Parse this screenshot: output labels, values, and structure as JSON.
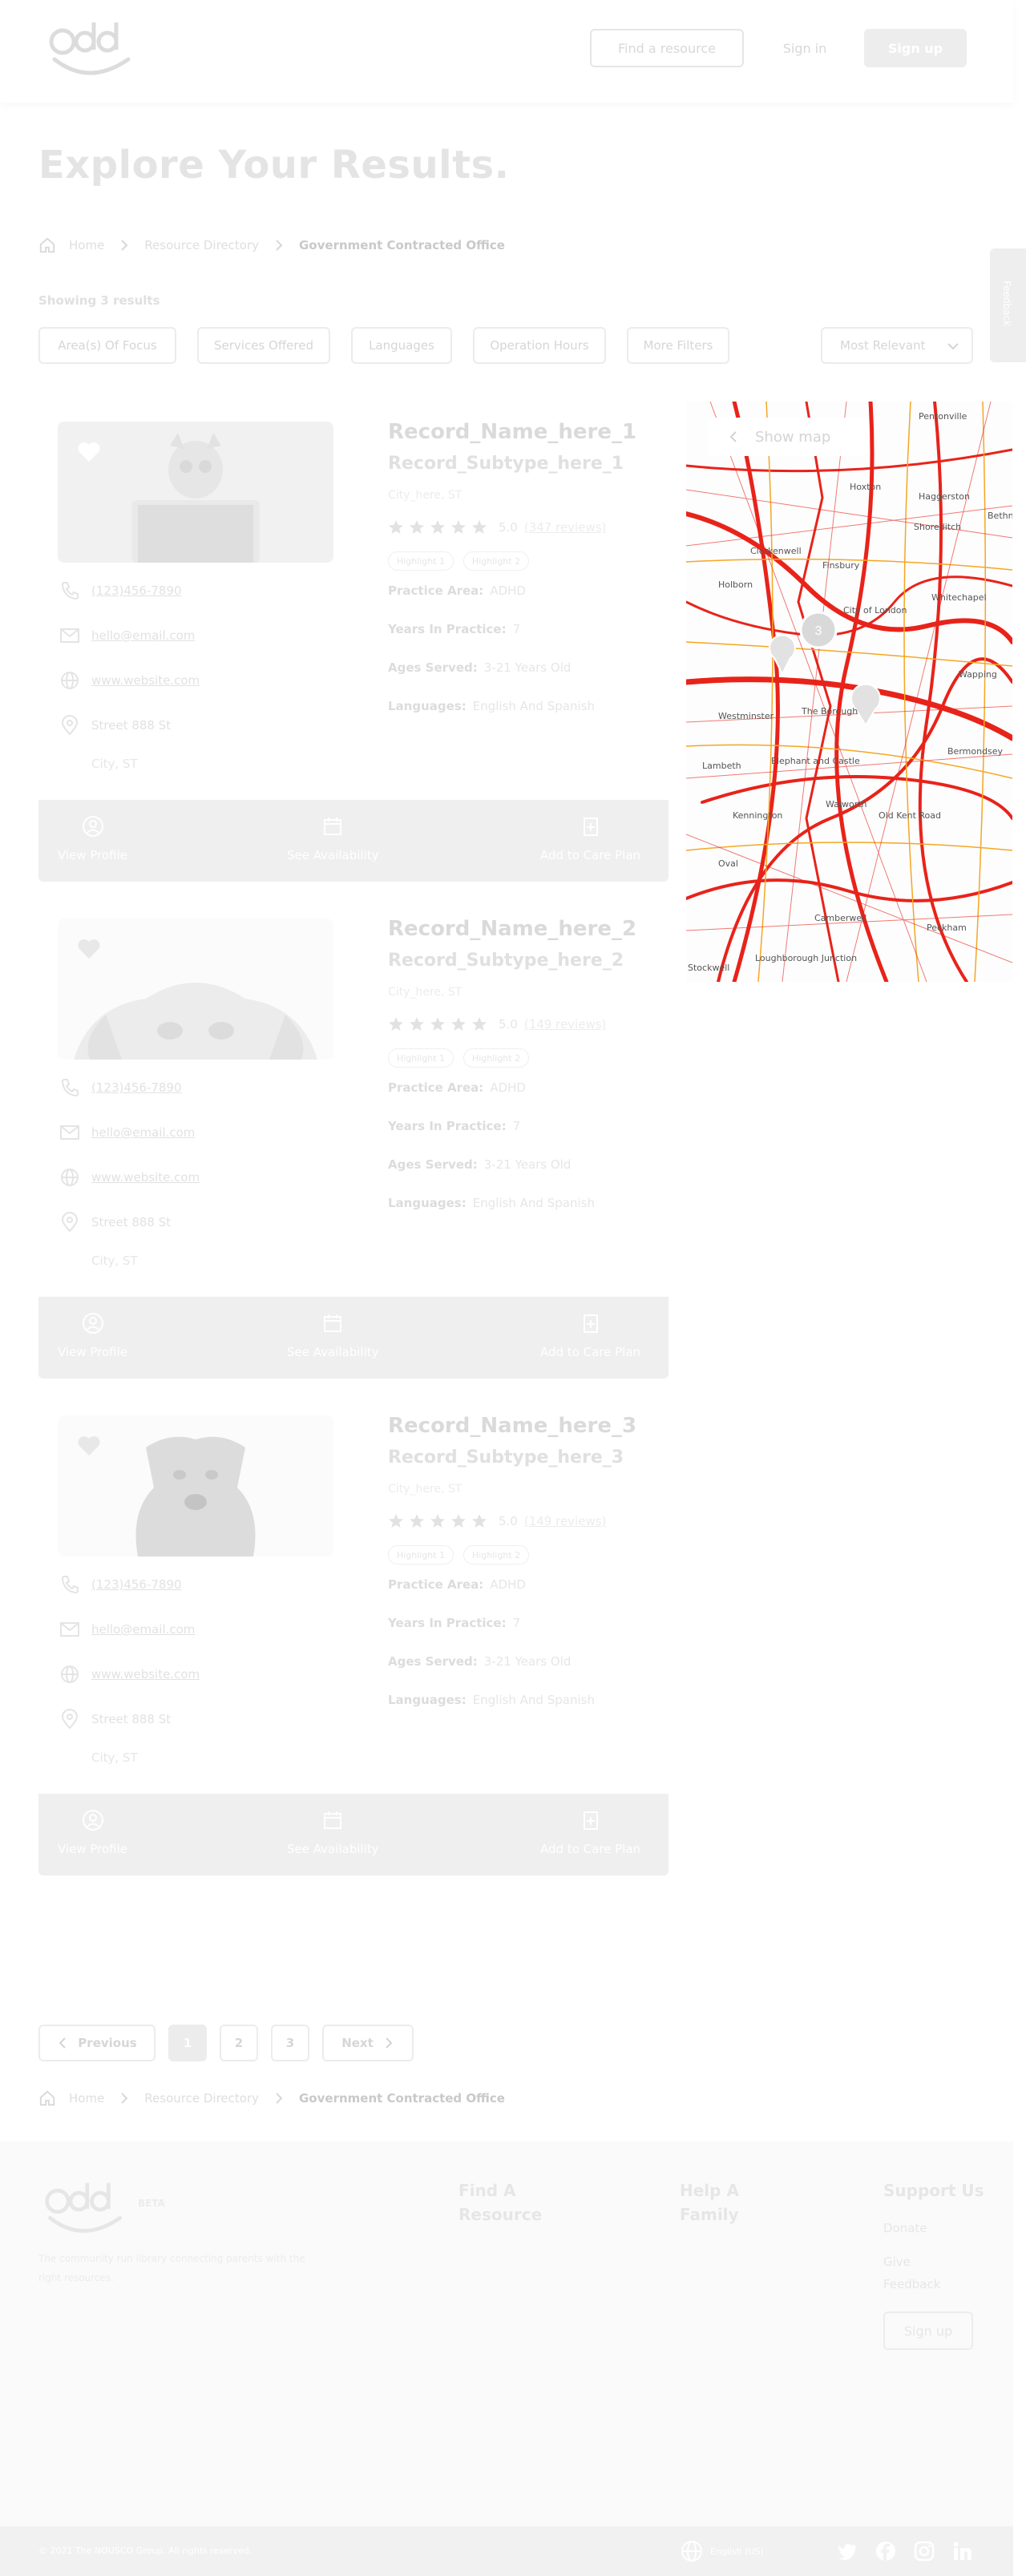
{
  "header": {
    "logo_text": "oddy",
    "find_resource": "Find a resource",
    "sign_in": "Sign in",
    "sign_up": "Sign up"
  },
  "page_title": "Explore Your Results.",
  "breadcrumb": {
    "home": "Home",
    "directory": "Resource Directory",
    "current": "Government Contracted Office"
  },
  "feedback": "Feedback",
  "results_count": "Showing 3 results",
  "filters": [
    "Area(s) Of Focus",
    "Services Offered",
    "Languages",
    "Operation Hours",
    "More Filters"
  ],
  "sort": {
    "selected": "Most Relevant"
  },
  "cards": [
    {
      "name": "Record_Name_here_1",
      "subtype": "Record_Subtype_here_1",
      "city_state": "City_here, ST",
      "stars": 5,
      "score": "5.0",
      "reviews": "(347 reviews)",
      "highlights": [
        "Highlight 1",
        "Highlight 2"
      ],
      "phone": "(123)456-7890",
      "email": "hello@email.com",
      "website": "www.website.com",
      "street": "Street 888 St",
      "city": "City, ST",
      "practice_area_label": "Practice Area:",
      "practice_area": "ADHD",
      "years_label": "Years In Practice:",
      "years": "7",
      "ages_label": "Ages Served:",
      "ages": "3-21 Years Old",
      "languages_label": "Languages:",
      "languages": "English And Spanish"
    },
    {
      "name": "Record_Name_here_2",
      "subtype": "Record_Subtype_here_2",
      "city_state": "City_here, ST",
      "stars": 5,
      "score": "5.0",
      "reviews": "(149 reviews)",
      "highlights": [
        "Highlight 1",
        "Highlight 2"
      ],
      "phone": "(123)456-7890",
      "email": "hello@email.com",
      "website": "www.website.com",
      "street": "Street 888 St",
      "city": "City, ST",
      "practice_area_label": "Practice Area:",
      "practice_area": "ADHD",
      "years_label": "Years In Practice:",
      "years": "7",
      "ages_label": "Ages Served:",
      "ages": "3-21 Years Old",
      "languages_label": "Languages:",
      "languages": "English And Spanish"
    },
    {
      "name": "Record_Name_here_3",
      "subtype": "Record_Subtype_here_3",
      "city_state": "City_here, ST",
      "stars": 5,
      "score": "5.0",
      "reviews": "(149 reviews)",
      "highlights": [
        "Highlight 1",
        "Highlight 2"
      ],
      "phone": "(123)456-7890",
      "email": "hello@email.com",
      "website": "www.website.com",
      "street": "Street 888 St",
      "city": "City, ST",
      "practice_area_label": "Practice Area:",
      "practice_area": "ADHD",
      "years_label": "Years In Practice:",
      "years": "7",
      "ages_label": "Ages Served:",
      "ages": "3-21 Years Old",
      "languages_label": "Languages:",
      "languages": "English And Spanish"
    }
  ],
  "card_actions": {
    "view_profile": "View Profile",
    "see_availability": "See Availability",
    "add_to_care_plan": "Add to Care Plan"
  },
  "map": {
    "show_map": "Show map",
    "marker_count": "3",
    "labels": [
      "Pentonville",
      "Haggerston",
      "Bethn",
      "Hoxton",
      "Shoreditch",
      "Clerkenwell",
      "Finsbury",
      "Whitechapel",
      "Holborn",
      "City of London",
      "Wapping",
      "Westminster",
      "The Borough",
      "Bermondsey",
      "Lambeth",
      "Elephant and Castle",
      "Kennington",
      "Walworth",
      "Old Kent Road",
      "Oval",
      "Camberwell",
      "Peckham",
      "Loughborough Junction",
      "Stockwell"
    ]
  },
  "pagination": {
    "previous": "Previous",
    "pages": [
      "1",
      "2",
      "3"
    ],
    "next": "Next",
    "active_page": "1"
  },
  "footer": {
    "beta": "BETA",
    "tagline": "The community run library connecting parents with the right resources.",
    "find_resource": "Find A Resource",
    "help_family": "Help A Family",
    "support_us": "Support Us",
    "donate": "Donate",
    "give_feedback": "Give Feedback",
    "sign_up": "Sign up"
  },
  "bottom": {
    "copyright": "© 2021 The NOUSCO Group. All rights reserved.",
    "language": "English (US)"
  },
  "colors": {
    "map_roads": "#e8231a",
    "map_minor": "#f5a623"
  }
}
